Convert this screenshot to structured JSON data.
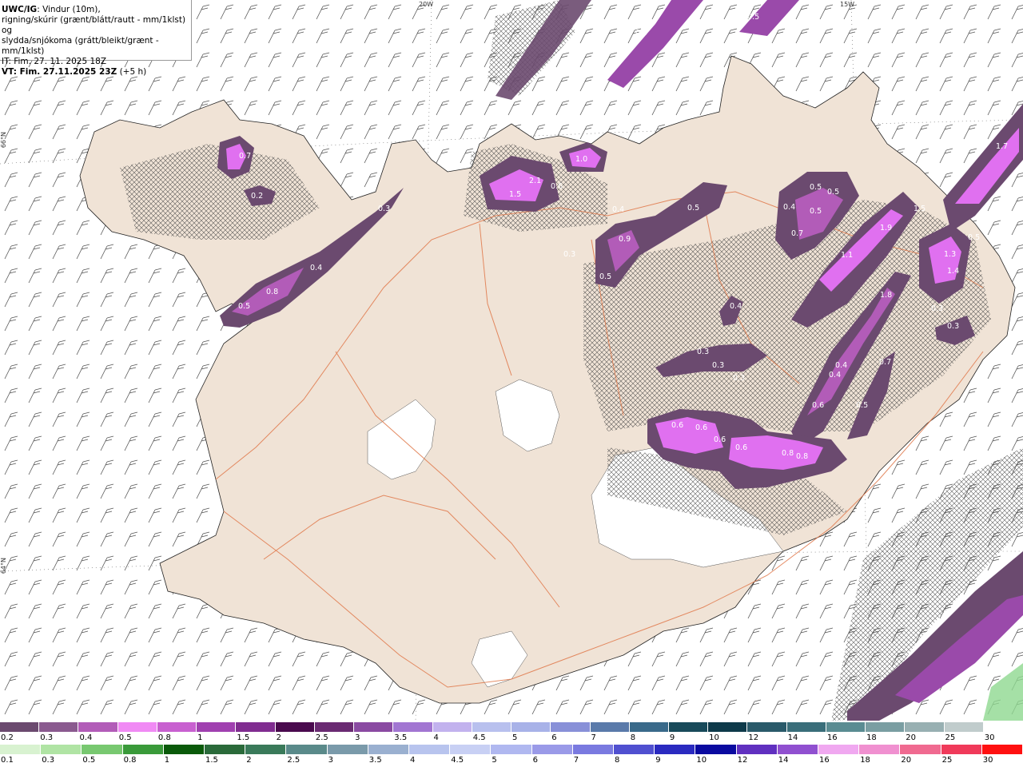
{
  "header": {
    "model": "UWC/IG",
    "line1_rest": ": Vindur (10m),",
    "line2": "rigning/skúrir (grænt/blátt/rautt - mm/1klst) og",
    "line3": "slydda/snjókoma (grátt/bleikt/grænt - mm/1klst)",
    "line4": "IT: Fim. 27. 11. 2025 18Z",
    "line5_bold": "VT: Fim. 27.11.2025 23Z",
    "line5_rest": " (+5 h)"
  },
  "grid_labels": {
    "lon_20w": "20W",
    "lon_15w": "15W",
    "lat_66n": "66°N",
    "lat_64n": "64°N"
  },
  "colors": {
    "land": "#f0e3d6",
    "roads": "#e0784a",
    "glacier": "#ffffff",
    "sleet_dark": "#6e3c78",
    "sleet_mid": "#9a4aaa",
    "sleet_bright": "#e070f0",
    "rain_green": "#7fd07f"
  },
  "precip_values": [
    "0.5",
    "0.5",
    "0.5",
    "0.7",
    "0.2",
    "0.3",
    "0.4",
    "0.8",
    "0.5",
    "2.1",
    "1.5",
    "0.6",
    "1.0",
    "0.4",
    "0.3",
    "0.9",
    "0.5",
    "0.5",
    "0.5",
    "0.5",
    "0.4",
    "0.5",
    "0.7",
    "1.9",
    "1.1",
    "1.5",
    "1.3",
    "1.4",
    "0.5",
    "1.8",
    "0.3",
    "0.3",
    "0.4",
    "0.3",
    "0.3",
    "0.3",
    "0.4",
    "0.4",
    "0.6",
    "0.7",
    "0.5",
    "0.6",
    "0.6",
    "0.6",
    "0.6",
    "0.8",
    "0.8",
    "1.7"
  ],
  "snow_scale": {
    "labels": [
      "0.2",
      "0.3",
      "0.4",
      "0.5",
      "0.8",
      "1",
      "1.5",
      "2",
      "2.5",
      "3",
      "3.5",
      "4",
      "4.5",
      "5",
      "6",
      "7",
      "8",
      "9",
      "10",
      "12",
      "14",
      "16",
      "18",
      "20",
      "25",
      "30"
    ],
    "colors": [
      "#6b4a6f",
      "#8a5a8f",
      "#b25cb8",
      "#f08af4",
      "#c860d0",
      "#a040b0",
      "#802c90",
      "#4a0a4e",
      "#6a2a72",
      "#8a4aa2",
      "#a276d2",
      "#c2b2ee",
      "#b8c0ee",
      "#a8b2e8",
      "#8890d8",
      "#5a7aaa",
      "#3a6a8a",
      "#184a5a",
      "#0e3a4a",
      "#2a5a6a",
      "#3a6e7a",
      "#5a8c92",
      "#7a9ea2",
      "#98b0b2",
      "#c0cccc",
      "#ffffff"
    ]
  },
  "rain_scale": {
    "labels": [
      "0.1",
      "0.3",
      "0.5",
      "0.8",
      "1",
      "1.5",
      "2",
      "2.5",
      "3",
      "3.5",
      "4",
      "4.5",
      "5",
      "6",
      "7",
      "8",
      "9",
      "10",
      "12",
      "14",
      "16",
      "18",
      "20",
      "25",
      "30"
    ],
    "colors": [
      "#d8f2d0",
      "#b0e4a4",
      "#78c870",
      "#3a9a3a",
      "#0a5a0a",
      "#2a6a3a",
      "#3a7a5a",
      "#5a8a8a",
      "#7a9aaa",
      "#9ab0d0",
      "#b8c4ee",
      "#c8d0f4",
      "#b0b8f0",
      "#9a9ae8",
      "#7a7ae0",
      "#5050d0",
      "#2a2ac0",
      "#0a0aa0",
      "#6030c0",
      "#9050d0",
      "#f0a8f0",
      "#f090d0",
      "#f06a90",
      "#f03a5a",
      "#ff1010"
    ]
  }
}
